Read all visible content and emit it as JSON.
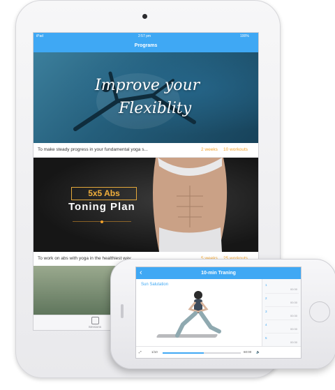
{
  "ipad": {
    "status": {
      "carrier": "iPad",
      "time": "2:57 pm",
      "battery": "100%"
    },
    "nav_title": "Programs",
    "programs": [
      {
        "banner_line1": "Improve your",
        "banner_line2": "Flexiblity",
        "description": "To make steady progress in your fundamental yoga s...",
        "weeks": "2 weeks",
        "workouts": "10 workouts"
      },
      {
        "tag": "5x5 Abs",
        "title": "Toning Plan",
        "description": "To work on abs with yoga in the healthiest way",
        "weeks": "5 weeks",
        "workouts": "25 workouts"
      }
    ],
    "tab_bar": {
      "sessions_label": "Sessions"
    }
  },
  "iphone": {
    "nav_title": "10-min Traning",
    "section_label": "Sun Salutation",
    "side_list": [
      {
        "num": "1",
        "time": "00:30"
      },
      {
        "num": "2",
        "time": "00:30"
      },
      {
        "num": "3",
        "time": "00:30"
      },
      {
        "num": "4",
        "time": "00:30"
      },
      {
        "num": "5",
        "time": "00:30"
      }
    ],
    "player": {
      "count": "1/10",
      "time": "60:00",
      "progress": 0.53
    }
  },
  "colors": {
    "accent": "#3fa8f4",
    "highlight": "#f2a22b"
  }
}
